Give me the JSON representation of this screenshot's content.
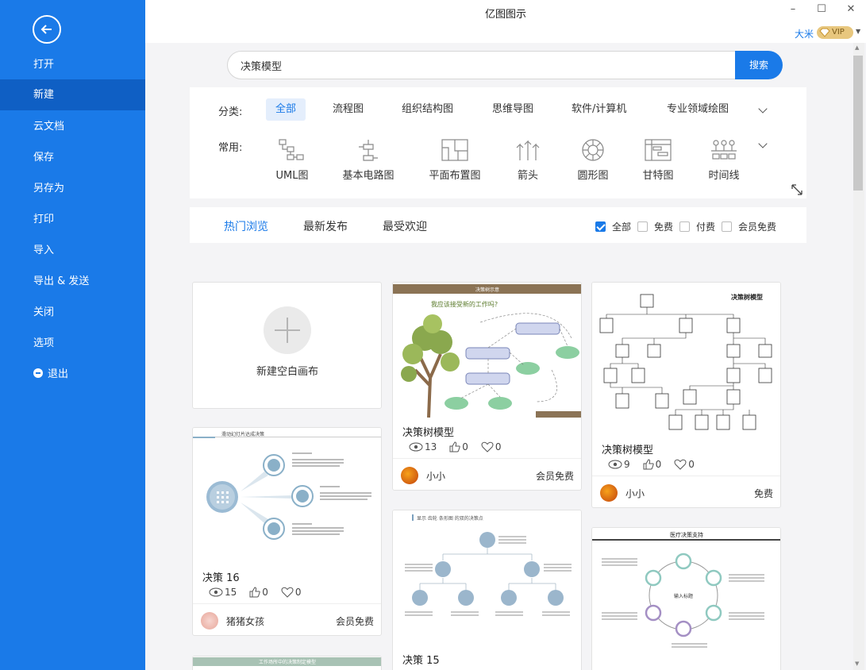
{
  "app": {
    "title": "亿图图示",
    "user": "大米",
    "vip": "VIP"
  },
  "window": {
    "minimize": "–",
    "maximize": "☐",
    "close": "✕"
  },
  "sidebar": {
    "items": [
      {
        "label": "打开"
      },
      {
        "label": "新建"
      },
      {
        "label": "云文档"
      },
      {
        "label": "保存"
      },
      {
        "label": "另存为"
      },
      {
        "label": "打印"
      },
      {
        "label": "导入"
      },
      {
        "label": "导出 & 发送"
      },
      {
        "label": "关闭"
      },
      {
        "label": "选项"
      },
      {
        "label": "退出"
      }
    ]
  },
  "search": {
    "value": "决策模型",
    "button": "搜索"
  },
  "filters": {
    "category_label": "分类:",
    "categories": [
      "全部",
      "流程图",
      "组织结构图",
      "思维导图",
      "软件/计算机",
      "专业领域绘图"
    ],
    "common_label": "常用:",
    "common": [
      "UML图",
      "基本电路图",
      "平面布置图",
      "箭头",
      "圆形图",
      "甘特图",
      "时间线"
    ]
  },
  "tabs": [
    "热门浏览",
    "最新发布",
    "最受欢迎"
  ],
  "checks": [
    "全部",
    "免费",
    "付费",
    "会员免费"
  ],
  "new_blank": "新建空白画布",
  "cards": [
    {
      "title": "决策树模型",
      "views": "13",
      "likes": "0",
      "favs": "0",
      "author": "小小",
      "price": "会员免费",
      "thumb_header": "决策树示意",
      "thumb_question": "我应该接受新的工作吗?"
    },
    {
      "title": "决策树模型",
      "views": "9",
      "likes": "0",
      "favs": "0",
      "author": "小小",
      "price": "免费",
      "thumb_header": "决策树模型"
    },
    {
      "title": "决策 16",
      "views": "15",
      "likes": "0",
      "favs": "0",
      "author": "猪猪女孩",
      "price": "会员免费",
      "thumb_header": "滑动幻灯片达成决策"
    },
    {
      "title": "决策 15",
      "thumb_header": "显示 齿轮 条形图 的双的决策点"
    },
    {
      "title": "",
      "thumb_header": "医疗决策支持",
      "thumb_center": "输入标题"
    },
    {
      "title": "",
      "thumb_header": "工作场所中的决策制定模型"
    }
  ]
}
